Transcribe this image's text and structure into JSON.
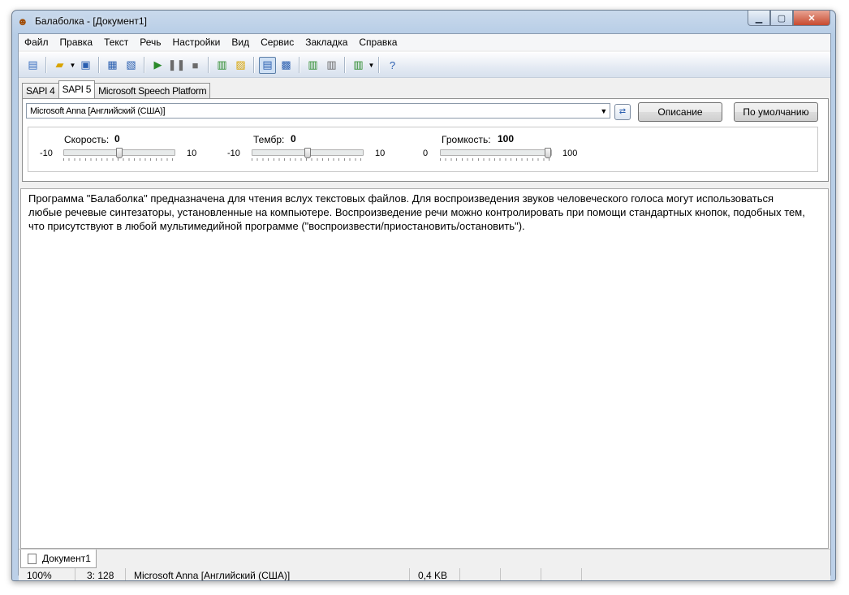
{
  "window": {
    "title": "Балаболка - [Документ1]"
  },
  "menu": [
    "Файл",
    "Правка",
    "Текст",
    "Речь",
    "Настройки",
    "Вид",
    "Сервис",
    "Закладка",
    "Справка"
  ],
  "tabs": [
    "SAPI 4",
    "SAPI 5",
    "Microsoft Speech Platform"
  ],
  "voice": {
    "selected": "Microsoft Anna [Английский (США)]",
    "description_button": "Описание",
    "default_button": "По умолчанию"
  },
  "sliders": {
    "speed": {
      "label": "Скорость:",
      "value": "0",
      "min": "-10",
      "max": "10",
      "position": 0.5
    },
    "pitch": {
      "label": "Тембр:",
      "value": "0",
      "min": "-10",
      "max": "10",
      "position": 0.5
    },
    "volume": {
      "label": "Громкость:",
      "value": "100",
      "min": "0",
      "max": "100",
      "position": 1.0
    }
  },
  "editor": {
    "text": "Программа \"Балаболка\" предназначена для чтения вслух текстовых файлов. Для воспроизведения звуков человеческого голоса могут использоваться любые речевые синтезаторы, установленные на компьютере. Воспроизведение речи можно контролировать при помощи стандартных кнопок, подобных тем, что присутствуют в любой мультимедийной программе (\"воспроизвести/приостановить/остановить\")."
  },
  "document_tab": "Документ1",
  "status": {
    "zoom": "100%",
    "position": "3: 128",
    "voice": "Microsoft Anna [Английский (США)]",
    "size": "0,4 KB"
  }
}
